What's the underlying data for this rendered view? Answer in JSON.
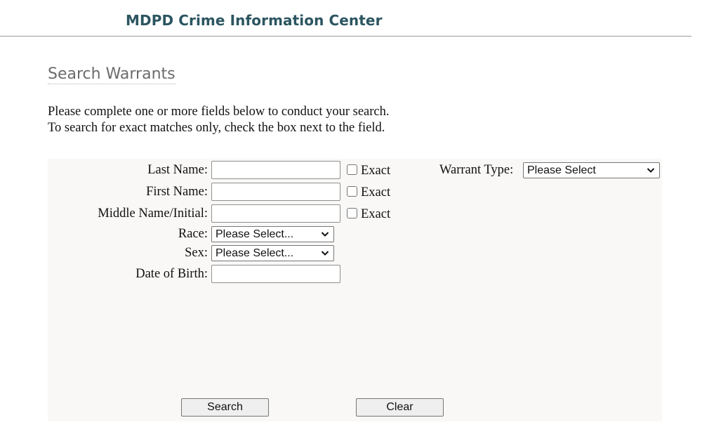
{
  "header": {
    "site_title": "MDPD Crime Information Center"
  },
  "page": {
    "title": "Search Warrants",
    "intro_line1": "Please complete one or more fields below to conduct your search.",
    "intro_line2": "To search for exact matches only, check the box next to the field."
  },
  "form": {
    "last_name": {
      "label": "Last Name:",
      "value": "",
      "exact_label": "Exact",
      "exact_checked": false
    },
    "first_name": {
      "label": "First Name:",
      "value": "",
      "exact_label": "Exact",
      "exact_checked": false
    },
    "middle_name": {
      "label": "Middle Name/Initial:",
      "value": "",
      "exact_label": "Exact",
      "exact_checked": false
    },
    "race": {
      "label": "Race:",
      "selected": "Please Select..."
    },
    "sex": {
      "label": "Sex:",
      "selected": "Please Select..."
    },
    "dob": {
      "label": "Date of Birth:",
      "value": ""
    },
    "warrant_type": {
      "label": "Warrant Type:",
      "selected": "Please Select"
    },
    "search_label": "Search",
    "clear_label": "Clear"
  }
}
